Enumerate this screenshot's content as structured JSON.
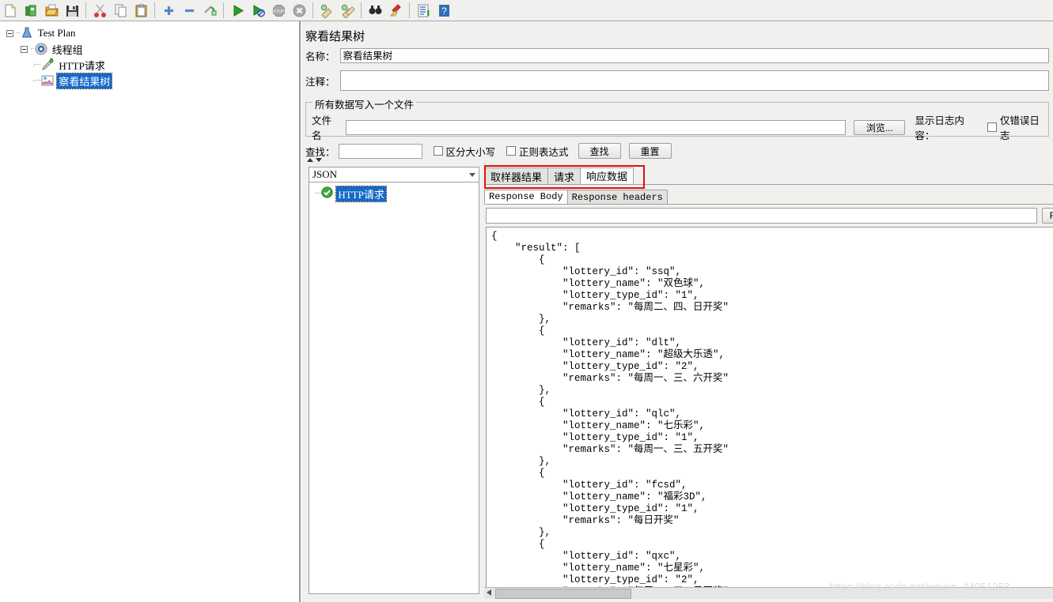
{
  "toolbar": {
    "buttons": [
      {
        "name": "new-icon",
        "label": "新建"
      },
      {
        "name": "templates-icon",
        "label": "模板"
      },
      {
        "name": "open-icon",
        "label": "打开"
      },
      {
        "name": "save-icon",
        "label": "保存"
      },
      {
        "name": "cut-icon",
        "label": "剪切"
      },
      {
        "name": "copy-icon",
        "label": "复制"
      },
      {
        "name": "paste-icon",
        "label": "粘贴"
      },
      {
        "name": "expand-icon",
        "label": "展开全部"
      },
      {
        "name": "collapse-icon",
        "label": "收起全部"
      },
      {
        "name": "toggle-icon",
        "label": "切换"
      },
      {
        "name": "start-icon",
        "label": "启动"
      },
      {
        "name": "start-no-pause-icon",
        "label": "无间隔启动"
      },
      {
        "name": "stop-icon",
        "label": "停止"
      },
      {
        "name": "shutdown-icon",
        "label": "关闭"
      },
      {
        "name": "clear-icon",
        "label": "清除"
      },
      {
        "name": "clear-all-icon",
        "label": "清除全部"
      },
      {
        "name": "search-icon",
        "label": "查找"
      },
      {
        "name": "reset-search-icon",
        "label": "重置查找"
      },
      {
        "name": "function-helper-icon",
        "label": "函数助手"
      },
      {
        "name": "help-icon",
        "label": "帮助"
      }
    ]
  },
  "tree": {
    "items": [
      {
        "label": "Test Plan",
        "icon": "test-plan-icon",
        "depth": 0,
        "selected": false
      },
      {
        "label": "线程组",
        "icon": "thread-group-icon",
        "depth": 1,
        "selected": false
      },
      {
        "label": "HTTP请求",
        "icon": "http-request-icon",
        "depth": 2,
        "selected": false
      },
      {
        "label": "察看结果树",
        "icon": "view-results-tree-icon",
        "depth": 2,
        "selected": true
      }
    ]
  },
  "panel": {
    "title": "察看结果树",
    "name_label": "名称：",
    "name_value": "察看结果树",
    "comment_label": "注释：",
    "comment_value": "",
    "group_title": "所有数据写入一个文件",
    "filename_label": "文件名",
    "filename_value": "",
    "browse_button": "浏览...",
    "log_display_label": "显示日志内容：",
    "errors_only_label": "仅错误日志"
  },
  "search": {
    "label": "查找：",
    "value": "",
    "case_sensitive_label": "区分大小写",
    "regex_label": "正则表达式",
    "find_button": "查找",
    "reset_button": "重置"
  },
  "results": {
    "render_selected": "JSON",
    "items": [
      {
        "label": "HTTP请求",
        "status": "success",
        "selected": true
      }
    ]
  },
  "tabs": {
    "main": [
      {
        "label": "取样器结果",
        "active": false
      },
      {
        "label": "请求",
        "active": false
      },
      {
        "label": "响应数据",
        "active": true
      }
    ],
    "sub": [
      {
        "label": "Response Body",
        "active": true
      },
      {
        "label": "Response headers",
        "active": false
      }
    ],
    "find_field_value": "",
    "find_button": "Fin"
  },
  "response": {
    "lottery_entries": [
      {
        "lottery_id": "ssq",
        "lottery_name": "双色球",
        "lottery_type_id": "1",
        "remarks": "每周二、四、日开奖"
      },
      {
        "lottery_id": "dlt",
        "lottery_name": "超级大乐透",
        "lottery_type_id": "2",
        "remarks": "每周一、三、六开奖"
      },
      {
        "lottery_id": "qlc",
        "lottery_name": "七乐彩",
        "lottery_type_id": "1",
        "remarks": "每周一、三、五开奖"
      },
      {
        "lottery_id": "fcsd",
        "lottery_name": "福彩3D",
        "lottery_type_id": "1",
        "remarks": "每日开奖"
      },
      {
        "lottery_id": "qxc",
        "lottery_name": "七星彩",
        "lottery_type_id": "2",
        "remarks": "每周二、五、日开奖"
      }
    ],
    "body_text": "{\n    \"result\": [\n        {\n            \"lottery_id\": \"ssq\",\n            \"lottery_name\": \"双色球\",\n            \"lottery_type_id\": \"1\",\n            \"remarks\": \"每周二、四、日开奖\"\n        },\n        {\n            \"lottery_id\": \"dlt\",\n            \"lottery_name\": \"超级大乐透\",\n            \"lottery_type_id\": \"2\",\n            \"remarks\": \"每周一、三、六开奖\"\n        },\n        {\n            \"lottery_id\": \"qlc\",\n            \"lottery_name\": \"七乐彩\",\n            \"lottery_type_id\": \"1\",\n            \"remarks\": \"每周一、三、五开奖\"\n        },\n        {\n            \"lottery_id\": \"fcsd\",\n            \"lottery_name\": \"福彩3D\",\n            \"lottery_type_id\": \"1\",\n            \"remarks\": \"每日开奖\"\n        },\n        {\n            \"lottery_id\": \"qxc\",\n            \"lottery_name\": \"七星彩\",\n            \"lottery_type_id\": \"2\",\n            \"remarks\": \"每周二、五、日开奖\""
  },
  "watermark": {
    "text": "https://blog.csdn.net/weixin_44051253"
  },
  "colors": {
    "selection_blue": "#1569c7",
    "annotation_red": "#e01010",
    "panel_bg": "#f0f0ee"
  }
}
